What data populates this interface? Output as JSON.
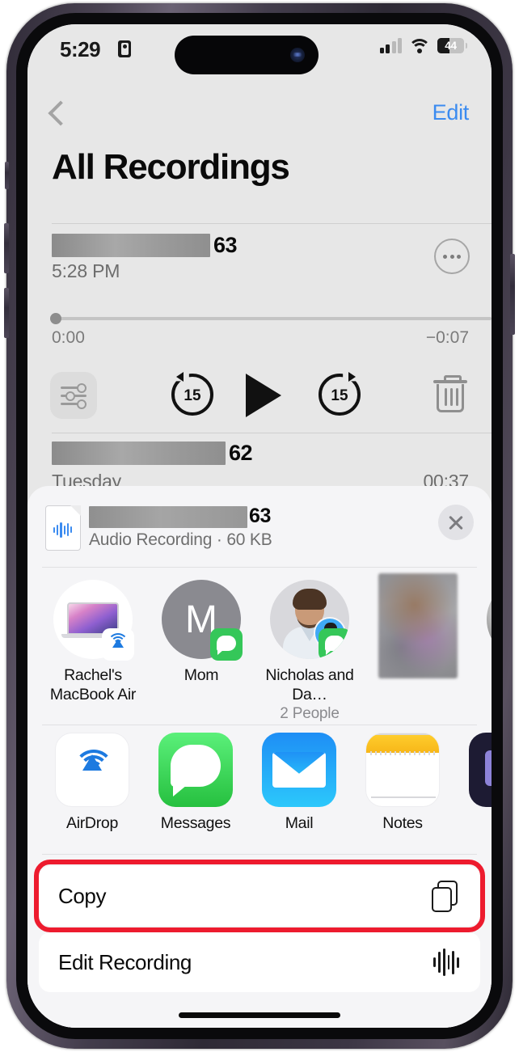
{
  "status_bar": {
    "time": "5:29",
    "recording_indicator_icon": "recording-lock-icon",
    "signal_icon": "cellular-signal-icon",
    "wifi_icon": "wifi-icon",
    "battery_percent": "44",
    "battery_level": 44
  },
  "nav": {
    "back_icon": "back-chevron-icon",
    "edit_label": "Edit",
    "edit_color": "#3b8bf0"
  },
  "page": {
    "title": "All Recordings"
  },
  "recordings": [
    {
      "name_redacted": true,
      "number": "63",
      "subtitle": "5:28 PM",
      "more_icon": "ellipsis-circle-icon",
      "expanded": true,
      "player": {
        "elapsed": "0:00",
        "remaining": "−0:07",
        "progress_percent": 0
      }
    },
    {
      "name_redacted": true,
      "number": "62",
      "subtitle": "Tuesday",
      "duration": "00:37",
      "expanded": false
    }
  ],
  "transport": {
    "enhance_icon": "audio-sliders-icon",
    "skip_back_label": "15",
    "skip_back_icon": "skip-back-15-icon",
    "play_icon": "play-icon",
    "skip_forward_label": "15",
    "skip_forward_icon": "skip-forward-15-icon",
    "delete_icon": "trash-icon"
  },
  "share_sheet": {
    "file": {
      "icon": "audio-file-icon",
      "name_redacted": true,
      "number": "63",
      "meta": "Audio Recording · 60 KB"
    },
    "close_icon": "close-icon",
    "contacts": [
      {
        "name": "Rachel's MacBook Air",
        "sub": "",
        "avatar": "macbook-air-icon",
        "badge": "airdrop-badge-icon"
      },
      {
        "name": "Mom",
        "sub": "",
        "avatar": "monogram-avatar",
        "monogram": "M",
        "badge": "messages-badge-icon"
      },
      {
        "name": "Nicholas and Da…",
        "sub": "2 People",
        "avatar": "group-photo-avatar",
        "badge": "messages-badge-icon"
      },
      {
        "name": "",
        "sub": "",
        "avatar": "blurred-contact-photo",
        "badge": ""
      },
      {
        "name": "",
        "sub": "",
        "avatar": "bw-contact-photo-partial",
        "badge": ""
      }
    ],
    "apps": [
      {
        "label": "AirDrop",
        "icon": "airdrop-app-icon"
      },
      {
        "label": "Messages",
        "icon": "messages-app-icon"
      },
      {
        "label": "Mail",
        "icon": "mail-app-icon"
      },
      {
        "label": "Notes",
        "icon": "notes-app-icon"
      },
      {
        "label": "",
        "icon": "partial-app-icon"
      }
    ],
    "actions": [
      {
        "label": "Copy",
        "icon": "copy-icon",
        "highlighted": true
      },
      {
        "label": "Edit Recording",
        "icon": "waveform-icon",
        "highlighted": false
      }
    ]
  },
  "annotation": {
    "highlight_color": "#ed1b2e",
    "target": "Copy"
  }
}
